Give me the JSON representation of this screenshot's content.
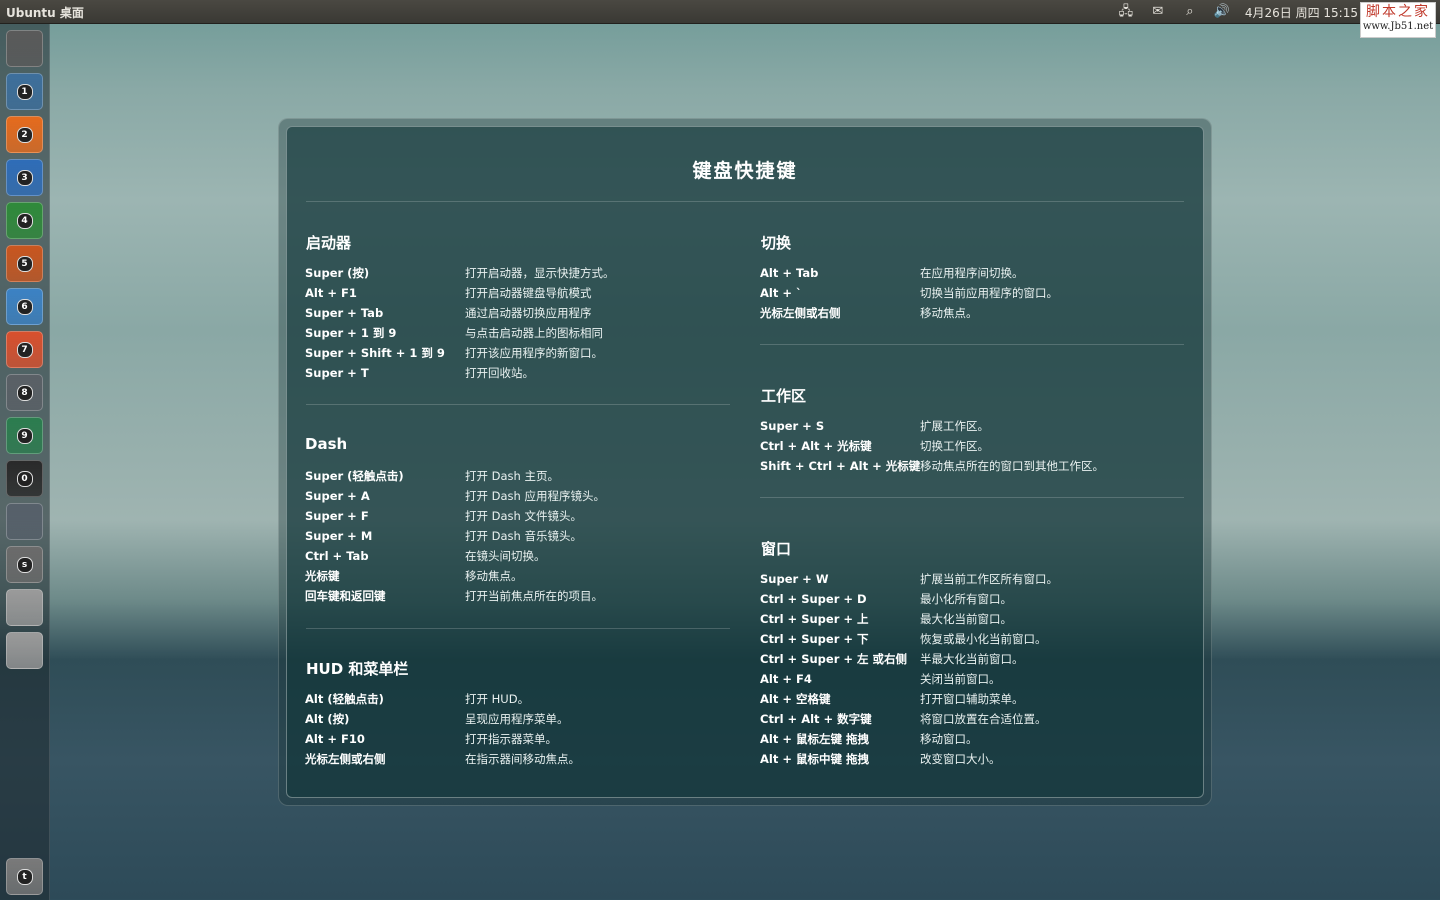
{
  "panel": {
    "title": "Ubuntu 桌面",
    "clock": "4月26日 周四 15:15",
    "indicators": [
      "network-icon",
      "mail-icon",
      "search-icon",
      "volume-icon"
    ]
  },
  "watermark": {
    "line1": "脚本之家",
    "line2": "www.Jb51.net"
  },
  "launcher": {
    "items": [
      {
        "name": "dash-home",
        "num": ""
      },
      {
        "name": "files",
        "num": "1"
      },
      {
        "name": "firefox",
        "num": "2"
      },
      {
        "name": "libreoffice-writer",
        "num": "3"
      },
      {
        "name": "libreoffice-calc",
        "num": "4"
      },
      {
        "name": "libreoffice-impress",
        "num": "5"
      },
      {
        "name": "software-center",
        "num": "6"
      },
      {
        "name": "ubuntu-one",
        "num": "7"
      },
      {
        "name": "system-settings",
        "num": "8"
      },
      {
        "name": "workspace-switcher",
        "num": "9"
      },
      {
        "name": "terminal",
        "num": "0"
      },
      {
        "name": "tools",
        "num": ""
      },
      {
        "name": "save-disk",
        "num": "s"
      },
      {
        "name": "drive-1",
        "num": ""
      },
      {
        "name": "drive-2",
        "num": ""
      },
      {
        "name": "trash",
        "num": "t"
      }
    ]
  },
  "overlay": {
    "title": "键盘快捷键",
    "sections": {
      "launcher": {
        "title": "启动器",
        "rows": [
          {
            "key": "Super (按)",
            "desc": "打开启动器，显示快捷方式。"
          },
          {
            "key": "Alt + F1",
            "desc": "打开启动器键盘导航模式"
          },
          {
            "key": "Super + Tab",
            "desc": "通过启动器切换应用程序"
          },
          {
            "key": "Super + 1 到 9",
            "desc": "与点击启动器上的图标相同"
          },
          {
            "key": "Super + Shift + 1 到 9",
            "desc": "打开该应用程序的新窗口。"
          },
          {
            "key": "Super + T",
            "desc": "打开回收站。"
          }
        ]
      },
      "dash": {
        "title": "Dash",
        "rows": [
          {
            "key": "Super (轻触点击)",
            "desc": "打开 Dash 主页。"
          },
          {
            "key": "Super + A",
            "desc": "打开 Dash 应用程序镜头。"
          },
          {
            "key": "Super + F",
            "desc": "打开 Dash 文件镜头。"
          },
          {
            "key": "Super + M",
            "desc": "打开 Dash 音乐镜头。"
          },
          {
            "key": "Ctrl + Tab",
            "desc": "在镜头间切换。"
          },
          {
            "key": "光标键",
            "desc": "移动焦点。"
          },
          {
            "key": "回车键和返回键",
            "desc": "打开当前焦点所在的项目。"
          }
        ]
      },
      "hud": {
        "title": "HUD 和菜单栏",
        "rows": [
          {
            "key": "Alt (轻触点击)",
            "desc": "打开 HUD。"
          },
          {
            "key": "Alt (按)",
            "desc": "呈现应用程序菜单。"
          },
          {
            "key": "Alt + F10",
            "desc": "打开指示器菜单。"
          },
          {
            "key": "光标左侧或右侧",
            "desc": "在指示器间移动焦点。"
          }
        ]
      },
      "switching": {
        "title": "切换",
        "rows": [
          {
            "key": "Alt + Tab",
            "desc": "在应用程序间切换。"
          },
          {
            "key": "Alt + `",
            "desc": "切换当前应用程序的窗口。"
          },
          {
            "key": "光标左侧或右侧",
            "desc": "移动焦点。"
          }
        ]
      },
      "workspaces": {
        "title": "工作区",
        "rows": [
          {
            "key": "Super + S",
            "desc": "扩展工作区。"
          },
          {
            "key": "Ctrl + Alt + 光标键",
            "desc": "切换工作区。"
          },
          {
            "key": "Shift + Ctrl + Alt + 光标键",
            "desc": "移动焦点所在的窗口到其他工作区。"
          }
        ]
      },
      "windows": {
        "title": "窗口",
        "rows": [
          {
            "key": "Super + W",
            "desc": "扩展当前工作区所有窗口。"
          },
          {
            "key": "Ctrl + Super + D",
            "desc": "最小化所有窗口。"
          },
          {
            "key": "Ctrl + Super + 上",
            "desc": "最大化当前窗口。"
          },
          {
            "key": "Ctrl + Super + 下",
            "desc": "恢复或最小化当前窗口。"
          },
          {
            "key": "Ctrl + Super + 左 或右侧",
            "desc": "半最大化当前窗口。"
          },
          {
            "key": "Alt + F4",
            "desc": "关闭当前窗口。"
          },
          {
            "key": "Alt + 空格键",
            "desc": "打开窗口辅助菜单。"
          },
          {
            "key": "Ctrl + Alt + 数字键",
            "desc": "将窗口放置在合适位置。"
          },
          {
            "key": "Alt + 鼠标左键 拖拽",
            "desc": "移动窗口。"
          },
          {
            "key": "Alt + 鼠标中键 拖拽",
            "desc": "改变窗口大小。"
          }
        ]
      }
    }
  },
  "colors": {
    "panel_bg": "#3a3934",
    "overlay_bg": "#12373a",
    "launcher_palette": [
      "#5a5a5a",
      "#3d6f9c",
      "#e66b1d",
      "#2f6db8",
      "#2f8a3a",
      "#c9561f",
      "#3c82c4",
      "#d8502e",
      "#5a6066",
      "#2c7d4f",
      "#2a2a2a",
      "#56606a",
      "#6b6b6b",
      "#9a9a9a",
      "#9a9a9a",
      "#7a7a7a"
    ]
  }
}
